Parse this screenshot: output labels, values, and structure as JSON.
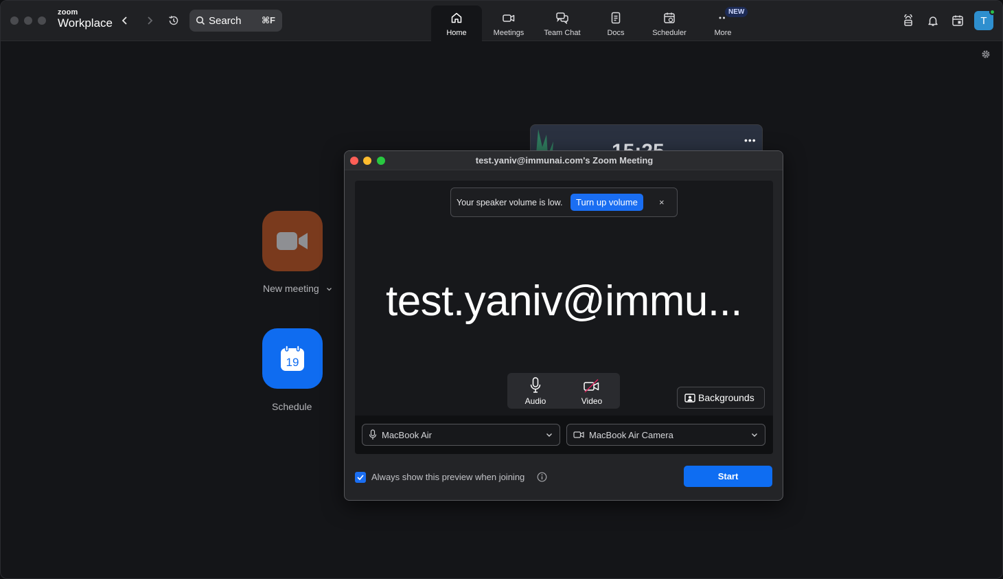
{
  "app": {
    "brand_small": "zoom",
    "brand_big": "Workplace",
    "search_label": "Search",
    "search_shortcut": "⌘F"
  },
  "tabs": [
    {
      "label": "Home",
      "icon": "home-icon",
      "active": true
    },
    {
      "label": "Meetings",
      "icon": "video-camera-icon",
      "active": false
    },
    {
      "label": "Team Chat",
      "icon": "chat-bubbles-icon",
      "active": false
    },
    {
      "label": "Docs",
      "icon": "document-icon",
      "active": false
    },
    {
      "label": "Scheduler",
      "icon": "calendar-clock-icon",
      "active": false
    },
    {
      "label": "More",
      "icon": "more-dots-icon",
      "active": false,
      "badge": "NEW"
    }
  ],
  "header_right": {
    "avatar_initial": "T",
    "icons": [
      "whiteboard-icon",
      "bell-icon",
      "calendar-icon"
    ]
  },
  "home": {
    "new_meeting_label": "New meeting",
    "schedule_label": "Schedule",
    "schedule_day": "19",
    "clock_time": "15:25"
  },
  "dialog": {
    "title": "test.yaniv@immunai.com's Zoom Meeting",
    "toast_message": "Your speaker volume is low.",
    "toast_action": "Turn up volume",
    "toast_close": "×",
    "display_name": "test.yaniv@immu...",
    "audio_label": "Audio",
    "video_label": "Video",
    "backgrounds_label": "Backgrounds",
    "mic_device": "MacBook Air",
    "camera_device": "MacBook Air Camera",
    "always_show_label": "Always show this preview when joining",
    "always_show_checked": true,
    "start_label": "Start"
  },
  "colors": {
    "accent": "#0e6df2",
    "new_meeting_tile": "#7a3a1d",
    "schedule_tile": "#0f6cf0",
    "background": "#141518"
  }
}
